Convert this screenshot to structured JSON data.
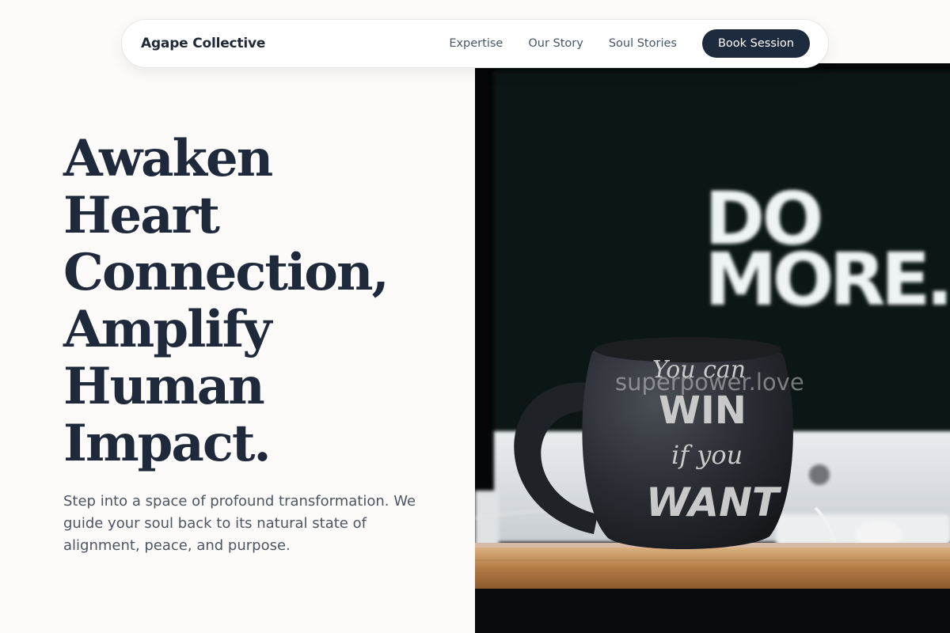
{
  "brand": {
    "name": "Agape Collective"
  },
  "nav": {
    "links": [
      "Expertise",
      "Our Story",
      "Soul Stories"
    ],
    "cta": "Book Session"
  },
  "hero": {
    "title_lines": [
      "Awaken",
      "Heart",
      "Connection,",
      "Amplify",
      "Human",
      "Impact."
    ],
    "subtitle": "Step into a space of profound transformation. We guide your soul back to its natural state of alignment, peace, and purpose."
  },
  "image": {
    "screen_text": [
      "DO",
      "MORE."
    ],
    "mug_text": [
      "You can",
      "WIN",
      "if you",
      "WANT"
    ]
  },
  "watermark": "superpower.love",
  "colors": {
    "accent": "#1e2a3d",
    "text": "#1e293b",
    "muted": "#4b5563",
    "background": "#fcfbf9"
  }
}
